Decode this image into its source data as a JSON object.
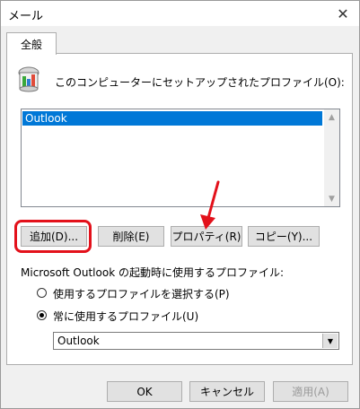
{
  "window": {
    "title": "メール"
  },
  "tab": {
    "label": "全般"
  },
  "profiles": {
    "heading": "このコンピューターにセットアップされたプロファイル(O):",
    "items": [
      {
        "name": "Outlook",
        "selected": true
      }
    ]
  },
  "buttons": {
    "add": "追加(D)...",
    "delete": "削除(E)",
    "properties": "プロパティ(R)",
    "copy": "コピー(Y)..."
  },
  "startup": {
    "label": "Microsoft Outlook の起動時に使用するプロファイル:",
    "option_prompt": "使用するプロファイルを選択する(P)",
    "option_always": "常に使用するプロファイル(U)",
    "selected_option": "always",
    "always_profile": "Outlook"
  },
  "footer": {
    "ok": "OK",
    "cancel": "キャンセル",
    "apply": "適用(A)"
  },
  "colors": {
    "highlight": "#e3111b",
    "selection": "#0078d7"
  }
}
